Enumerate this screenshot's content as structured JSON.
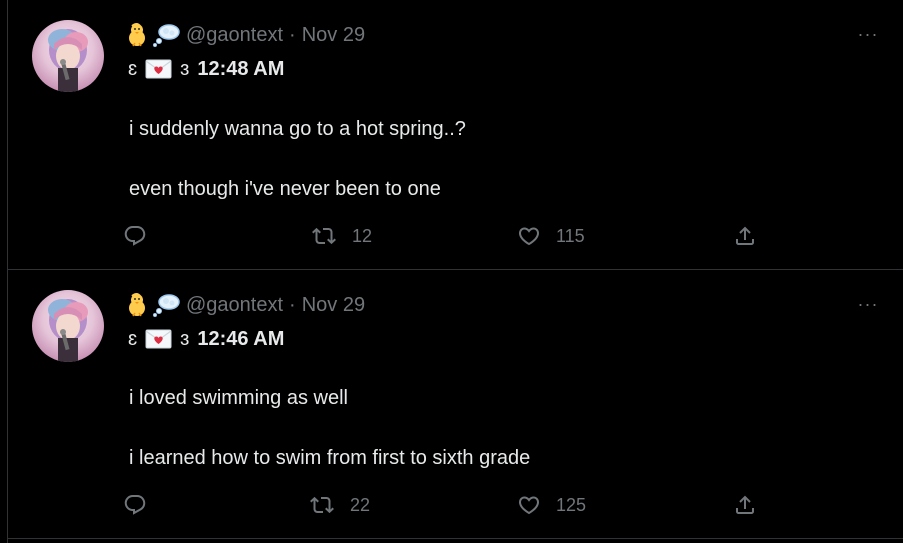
{
  "tweets": [
    {
      "handle": "@gaontext",
      "separator": "·",
      "date": "Nov 29",
      "bracket_left": "ɛ",
      "bracket_right": "ɜ",
      "time": "12:48 AM",
      "lines": [
        "i suddenly wanna go to a hot spring..?",
        "even though i've never been to one"
      ],
      "retweets": "12",
      "likes": "115",
      "more": "···"
    },
    {
      "handle": "@gaontext",
      "separator": "·",
      "date": "Nov 29",
      "bracket_left": "ɛ",
      "bracket_right": "ɜ",
      "time": "12:46 AM",
      "lines": [
        "i loved swimming as well",
        "i learned how to swim from first to sixth grade"
      ],
      "retweets": "22",
      "likes": "125",
      "more": "···"
    }
  ],
  "icons": {
    "reply": "reply-icon",
    "retweet": "retweet-icon",
    "like": "heart-icon",
    "share": "share-icon",
    "chick": "baby-chick-emoji-icon",
    "bubble": "thought-balloon-emoji-icon",
    "envelope": "love-letter-emoji-icon"
  },
  "colors": {
    "background": "#000000",
    "text": "#e7e9ea",
    "muted": "#71767b",
    "divider": "#2f3336"
  }
}
